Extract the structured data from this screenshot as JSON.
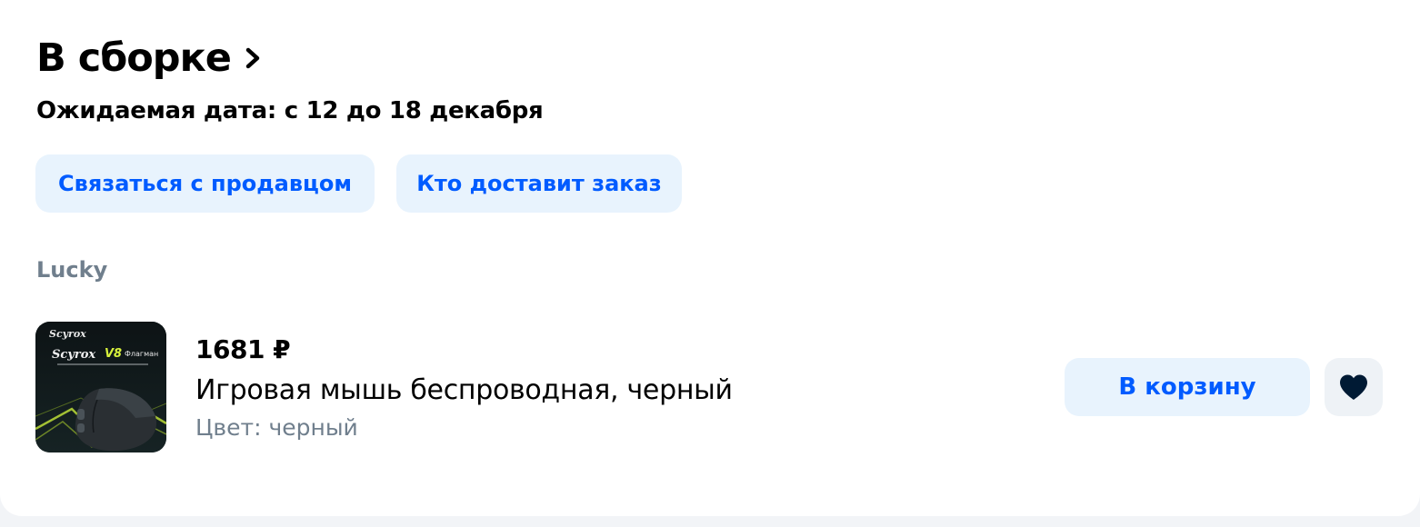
{
  "order": {
    "status_title": "В сборке",
    "expected_date": "Ожидаемая дата: с 12 до 18 декабря",
    "actions": {
      "contact_seller": "Связаться с продавцом",
      "who_delivers": "Кто доставит заказ"
    },
    "seller_name": "Lucky"
  },
  "product": {
    "price": "1681 ₽",
    "name": "Игровая мышь беспроводная, черный",
    "attribute": "Цвет: черный",
    "add_to_cart": "В корзину",
    "favorite_icon": "heart-icon",
    "image": {
      "brand": "Scyrox",
      "model": "V8",
      "tagline": "Флагман"
    }
  },
  "colors": {
    "accent_text": "#005bff",
    "soft_button_bg": "#e8f3fd",
    "secondary_text": "#707f8d",
    "heart_fill": "#001a34"
  }
}
